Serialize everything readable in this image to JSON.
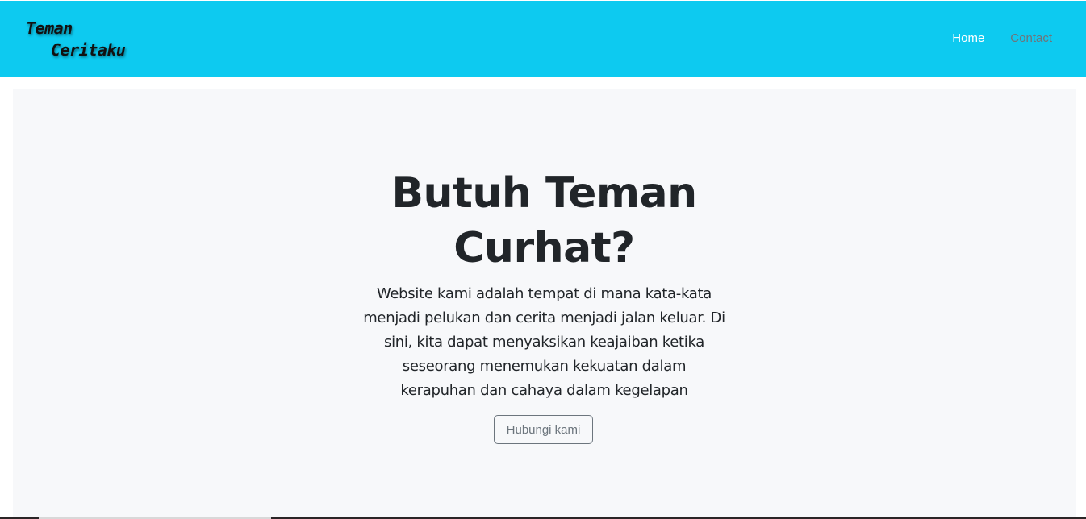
{
  "brand": {
    "line1": "Teman",
    "line2": "Ceritaku"
  },
  "nav": {
    "items": [
      {
        "label": "Home",
        "active": true
      },
      {
        "label": "Contact",
        "active": false
      }
    ]
  },
  "hero": {
    "title": "Butuh Teman Curhat?",
    "description": "Website kami adalah tempat di mana kata-kata menjadi pelukan dan cerita menjadi jalan keluar. Di sini, kita dapat menyaksikan keajaiban ketika seseorang menemukan kekuatan dalam kerapuhan dan cahaya dalam kegelapan",
    "button_label": "Hubungi kami"
  },
  "colors": {
    "navbar": "#0dcaf0",
    "hero_background": "#f7f8fa",
    "text": "#212529",
    "muted": "#6c757d"
  }
}
